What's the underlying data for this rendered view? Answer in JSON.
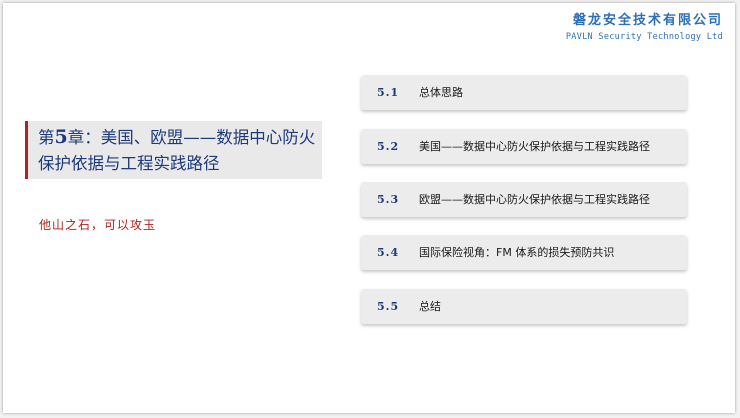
{
  "brand": {
    "name_cn": "磐龙安全技术有限公司",
    "name_en": "PAVLN Security Technology Ltd"
  },
  "chapter": {
    "prefix": "第",
    "number": "5",
    "title_rest": "章：美国、欧盟——数据中心防火保护依据与工程实践路径"
  },
  "quote": "他山之石，可以攻玉",
  "toc": [
    {
      "num": "5.1",
      "label": "总体思路"
    },
    {
      "num": "5.2",
      "label": "美国——数据中心防火保护依据与工程实践路径"
    },
    {
      "num": "5.3",
      "label": "欧盟——数据中心防火保护依据与工程实践路径"
    },
    {
      "num": "5.4",
      "label": "国际保险视角：FM 体系的损失预防共识"
    },
    {
      "num": "5.5",
      "label": "总结"
    }
  ],
  "colors": {
    "accent_red": "#b22222",
    "title_blue": "#1f3a7a",
    "brand_blue": "#2f6fb5"
  }
}
